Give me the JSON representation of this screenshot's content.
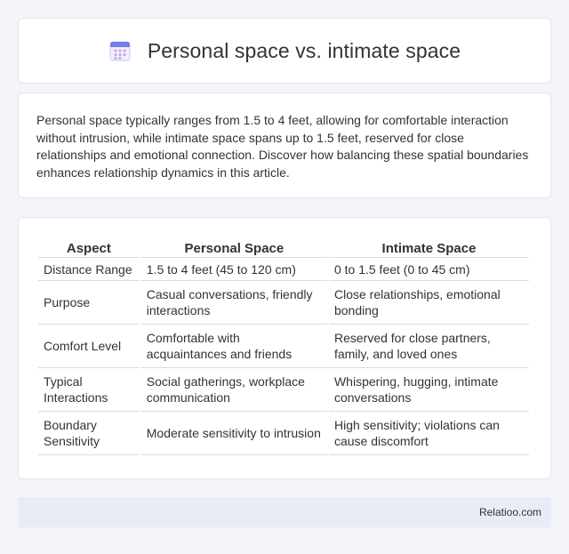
{
  "header": {
    "title": "Personal space vs. intimate space",
    "icon": "calendar-icon"
  },
  "intro": "Personal space typically ranges from 1.5 to 4 feet, allowing for comfortable interaction without intrusion, while intimate space spans up to 1.5 feet, reserved for close relationships and emotional connection. Discover how balancing these spatial boundaries enhances relationship dynamics in this article.",
  "table": {
    "headers": [
      "Aspect",
      "Personal Space",
      "Intimate Space"
    ],
    "rows": [
      [
        "Distance Range",
        "1.5 to 4 feet (45 to 120 cm)",
        "0 to 1.5 feet (0 to 45 cm)"
      ],
      [
        "Purpose",
        "Casual conversations, friendly interactions",
        "Close relationships, emotional bonding"
      ],
      [
        "Comfort Level",
        "Comfortable with acquaintances and friends",
        "Reserved for close partners, family, and loved ones"
      ],
      [
        "Typical Interactions",
        "Social gatherings, workplace communication",
        "Whispering, hugging, intimate conversations"
      ],
      [
        "Boundary Sensitivity",
        "Moderate sensitivity to intrusion",
        "High sensitivity; violations can cause discomfort"
      ]
    ]
  },
  "footer": {
    "brand": "Relatioo.com"
  }
}
